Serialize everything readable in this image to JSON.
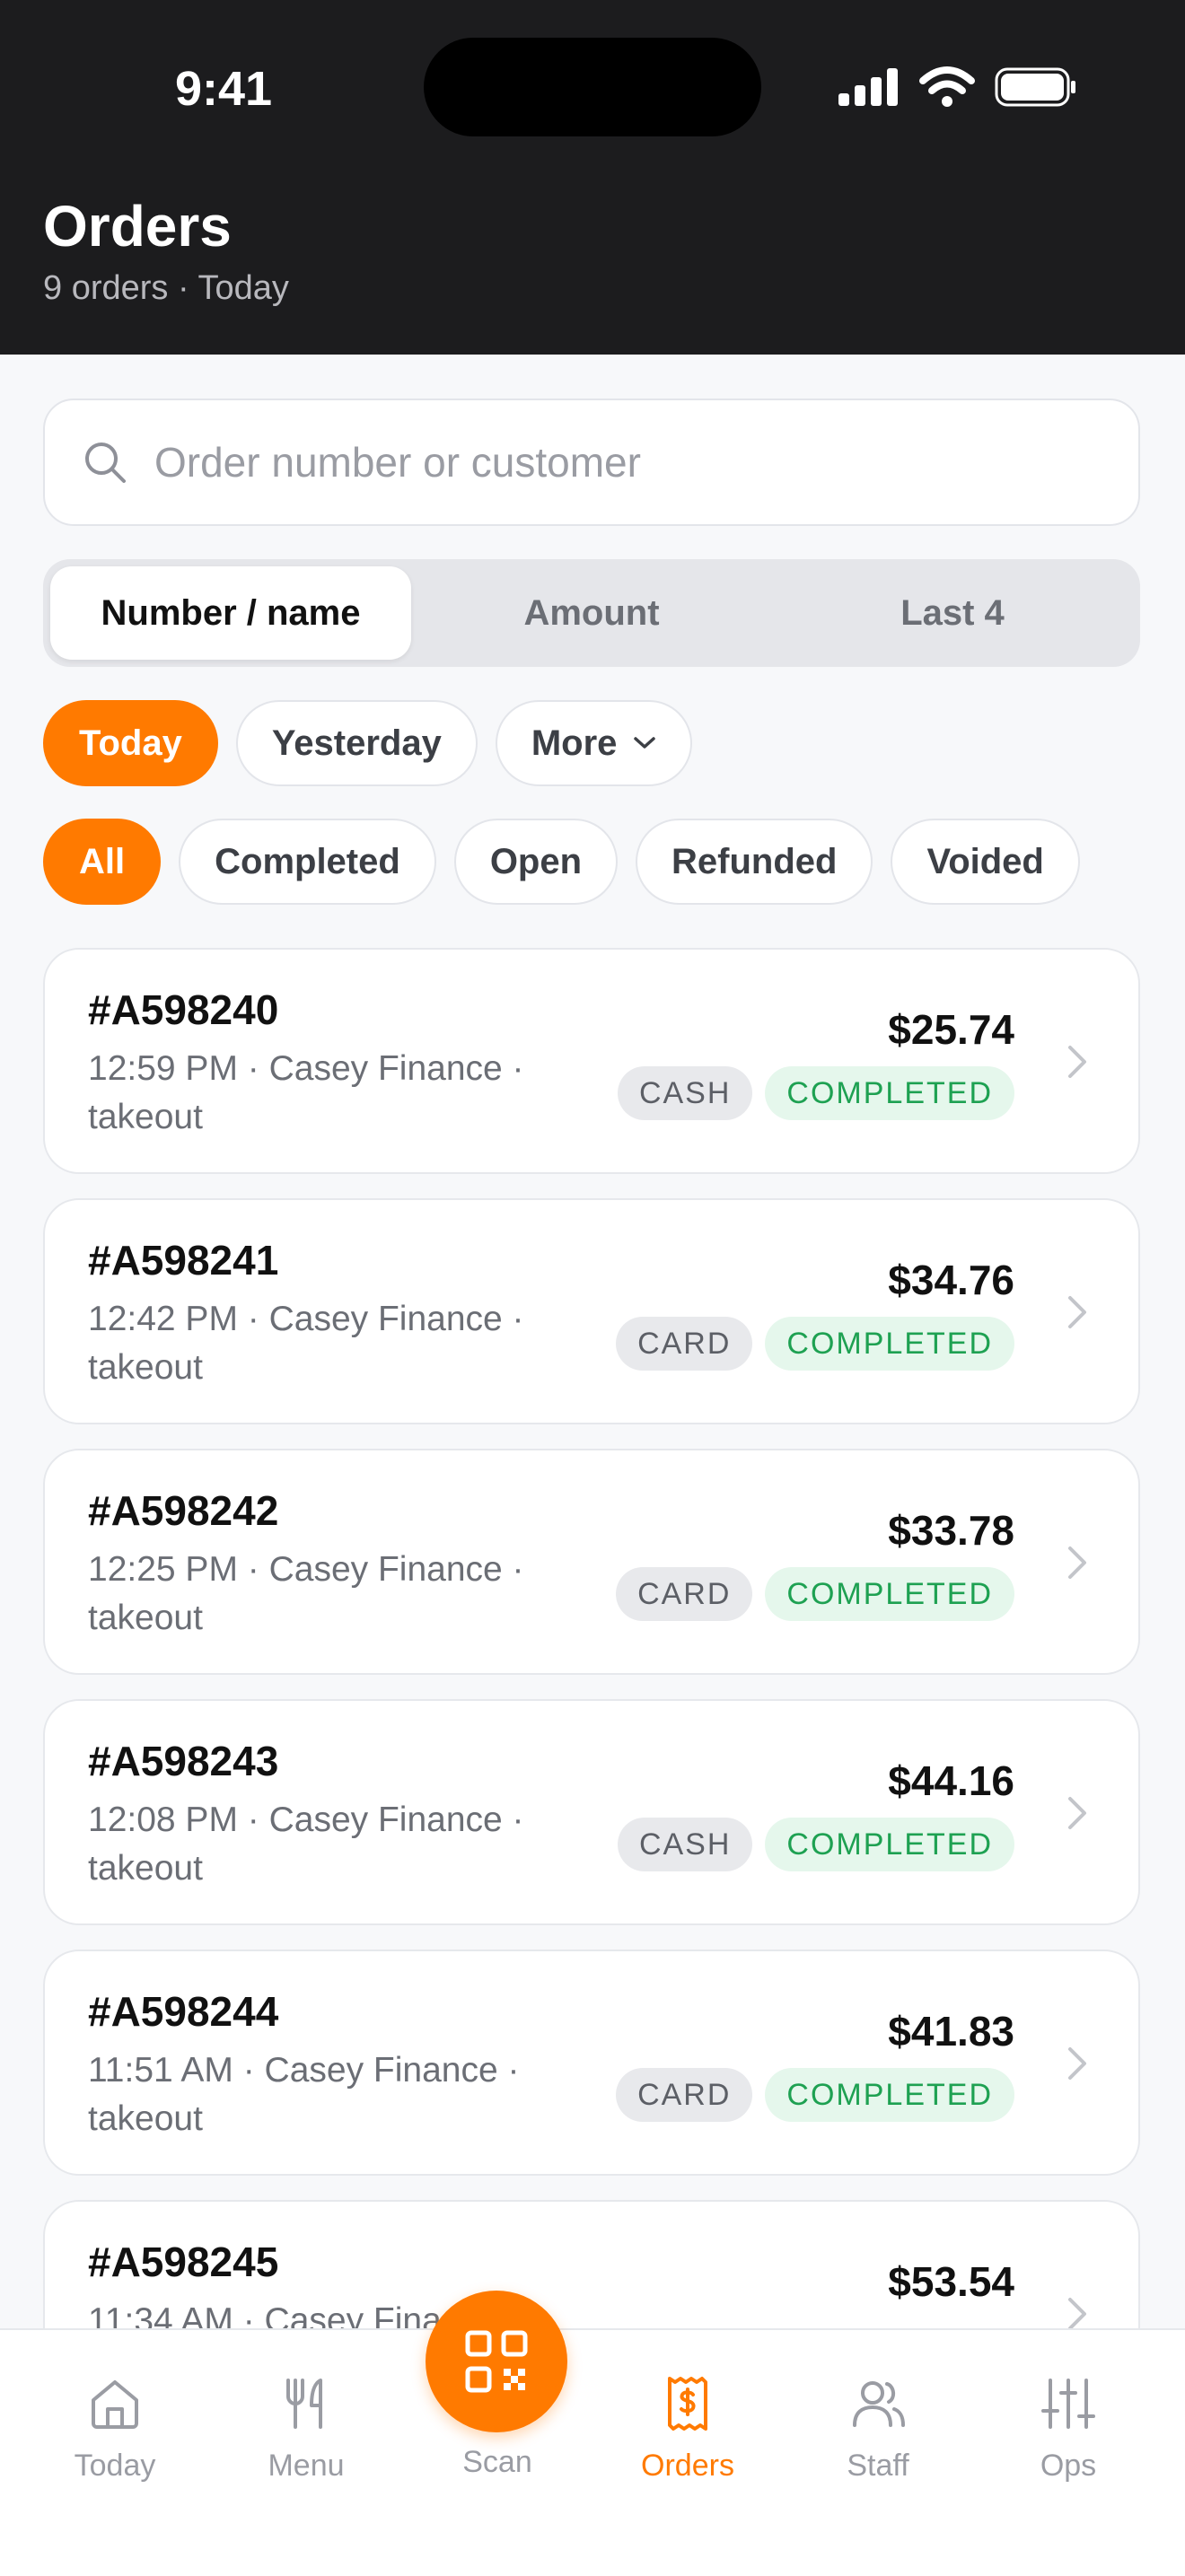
{
  "status_bar": {
    "time": "9:41"
  },
  "header": {
    "title": "Orders",
    "subtitle": "9 orders · Today"
  },
  "search": {
    "placeholder": "Order number or customer",
    "value": ""
  },
  "search_modes": [
    {
      "label": "Number / name",
      "active": true
    },
    {
      "label": "Amount",
      "active": false
    },
    {
      "label": "Last 4",
      "active": false
    }
  ],
  "date_filters": [
    {
      "label": "Today",
      "active": true
    },
    {
      "label": "Yesterday",
      "active": false
    },
    {
      "label": "More",
      "active": false
    }
  ],
  "status_filters": [
    {
      "label": "All",
      "active": true
    },
    {
      "label": "Completed",
      "active": false
    },
    {
      "label": "Open",
      "active": false
    },
    {
      "label": "Refunded",
      "active": false
    },
    {
      "label": "Voided",
      "active": false
    }
  ],
  "orders": [
    {
      "id": "#A598240",
      "meta": "12:59 PM · Casey Finance · takeout",
      "amount": "$25.74",
      "payment": "CASH",
      "status": "COMPLETED"
    },
    {
      "id": "#A598241",
      "meta": "12:42 PM · Casey Finance · takeout",
      "amount": "$34.76",
      "payment": "CARD",
      "status": "COMPLETED"
    },
    {
      "id": "#A598242",
      "meta": "12:25 PM · Casey Finance · takeout",
      "amount": "$33.78",
      "payment": "CARD",
      "status": "COMPLETED"
    },
    {
      "id": "#A598243",
      "meta": "12:08 PM · Casey Finance · takeout",
      "amount": "$44.16",
      "payment": "CASH",
      "status": "COMPLETED"
    },
    {
      "id": "#A598244",
      "meta": "11:51 AM · Casey Finance · takeout",
      "amount": "$41.83",
      "payment": "CARD",
      "status": "COMPLETED"
    },
    {
      "id": "#A598245",
      "meta": "11:34 AM · Casey Fina",
      "amount": "$53.54",
      "payment": "",
      "status": ""
    }
  ],
  "nav": [
    {
      "label": "Today",
      "icon": "home-icon",
      "active": false
    },
    {
      "label": "Menu",
      "icon": "utensils-icon",
      "active": false
    },
    {
      "label": "Scan",
      "icon": "qr-code-icon",
      "active": false
    },
    {
      "label": "Orders",
      "icon": "receipt-dollar-icon",
      "active": true
    },
    {
      "label": "Staff",
      "icon": "users-icon",
      "active": false
    },
    {
      "label": "Ops",
      "icon": "sliders-icon",
      "active": false
    }
  ],
  "colors": {
    "accent": "#ff7a00",
    "header_bg": "#1c1c1e",
    "success": "#1ea152"
  }
}
